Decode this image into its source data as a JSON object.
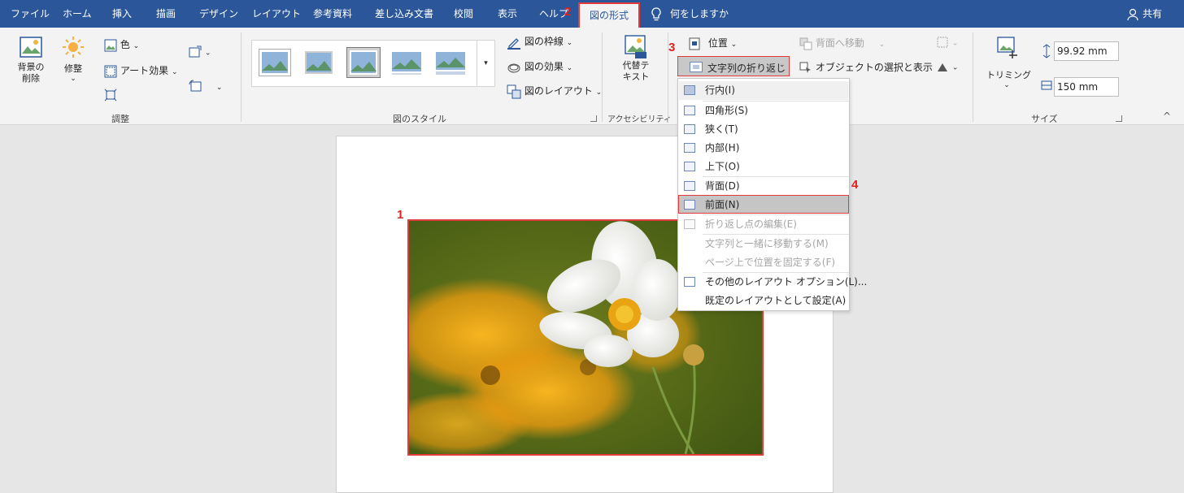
{
  "menubar": {
    "tabs": [
      "ファイル",
      "ホーム",
      "挿入",
      "描画",
      "デザイン",
      "レイアウト",
      "参考資料",
      "差し込み文書",
      "校閲",
      "表示",
      "ヘルプ"
    ],
    "active_tab": "図の形式",
    "tell_me": "何をしますか",
    "share": "共有"
  },
  "ribbon": {
    "adjust": {
      "remove_bg": "背景の\n削除",
      "corrections": "修整",
      "color": "色",
      "artistic": "アート効果",
      "label": "調整"
    },
    "styles": {
      "border": "図の枠線",
      "effects": "図の効果",
      "layout": "図のレイアウト",
      "label": "図のスタイル"
    },
    "accessibility": {
      "alt_text_1": "代替テ",
      "alt_text_2": "キスト",
      "label": "アクセシビリティ"
    },
    "arrange": {
      "position": "位置",
      "wrap_text": "文字列の折り返し",
      "send_backward": "背面へ移動",
      "selection_pane": "オブジェクトの選択と表示"
    },
    "size": {
      "crop": "トリミング",
      "height": "99.92 mm",
      "width": "150 mm",
      "label": "サイズ"
    }
  },
  "wrap_menu": {
    "items": [
      {
        "label": "行内(I)",
        "disabled": false
      },
      {
        "label": "四角形(S)",
        "disabled": false
      },
      {
        "label": "狭く(T)",
        "disabled": false
      },
      {
        "label": "内部(H)",
        "disabled": false
      },
      {
        "label": "上下(O)",
        "disabled": false
      },
      {
        "label": "背面(D)",
        "disabled": false
      },
      {
        "label": "前面(N)",
        "disabled": false
      },
      {
        "label": "折り返し点の編集(E)",
        "disabled": true
      },
      {
        "label": "文字列と一緒に移動する(M)",
        "disabled": true
      },
      {
        "label": "ページ上で位置を固定する(F)",
        "disabled": true
      },
      {
        "label": "その他のレイアウト オプション(L)...",
        "disabled": false
      },
      {
        "label": "既定のレイアウトとして設定(A)",
        "disabled": false
      }
    ]
  },
  "annotations": {
    "b1": "1",
    "b2": "2",
    "b3": "3",
    "b4": "4"
  },
  "colors": {
    "accent": "#2b579a",
    "highlight": "#e03c3c"
  }
}
